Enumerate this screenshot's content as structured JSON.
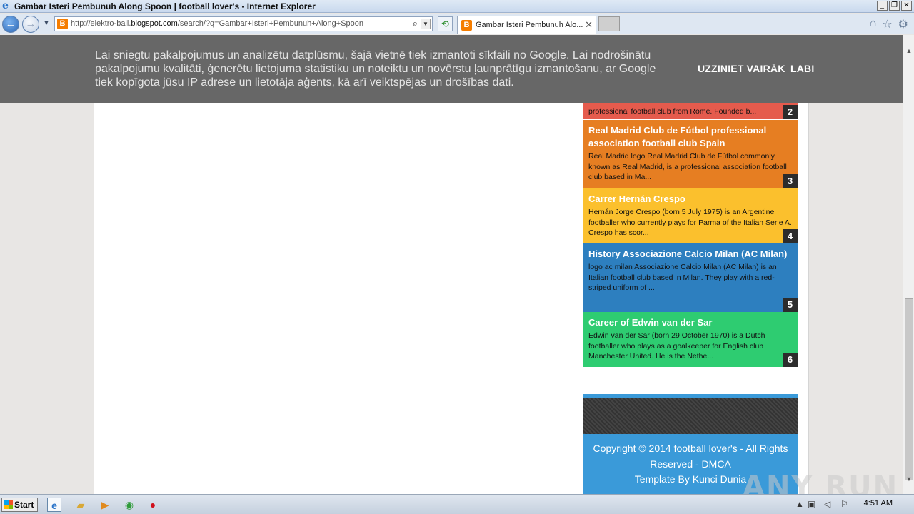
{
  "window": {
    "title": "Gambar Isteri Pembunuh Along Spoon | football lover's - Internet Explorer"
  },
  "navbar": {
    "url_prefix": "http://elektro-ball.",
    "url_domain": "blogspot.com",
    "url_suffix": "/search/?q=Gambar+Isteri+Pembunuh+Along+Spoon",
    "tab_title": "Gambar Isteri Pembunuh Alo..."
  },
  "cookie_banner": {
    "text": "Lai sniegtu pakalpojumus un analizētu datplūsmu, šajā vietnē tiek izmantoti sīkfaili no Google. Lai nodrošinātu pakalpojumu kvalitāti, ģenerētu lietojuma statistiku un noteiktu un novērstu ļaunprātīgu izmantošanu, ar Google tiek kopīgota jūsu IP adrese un lietotāja aģents, kā arī veiktspējas un drošības dati.",
    "learn_more": "UZZINIET VAIRĀK",
    "ok": "LABI"
  },
  "popular_posts": [
    {
      "title": "",
      "desc": "professional football club from Rome. Founded b...",
      "num": "2",
      "color": "#e55b4d"
    },
    {
      "title": "Real Madrid Club de Fútbol professional association football club Spain",
      "desc": " Real Madrid logo Real Madrid Club de Fútbol commonly known as Real Madrid, is a professional association football club based in Ma...",
      "num": "3",
      "color": "#e67e22"
    },
    {
      "title": "Carrer Hernán Crespo",
      "desc": "Hernán Jorge Crespo (born 5 July 1975) is an Argentine footballer who currently plays for Parma of the Italian Serie A. Crespo has scor...",
      "num": "4",
      "color": "#fbc02d"
    },
    {
      "title": "History Associazione Calcio Milan (AC Milan)",
      "desc": "logo  ac milan   Associazione Calcio Milan (AC Milan) is an Italian football club based in Milan. They play with a red-striped uniform of ...",
      "num": "5",
      "color": "#2d7fbf"
    },
    {
      "title": "Career of Edwin van der Sar",
      "desc": "Edwin van der Sar (born 29 October 1970) is a Dutch footballer who plays as a goalkeeper for English club Manchester United. He is the Nethe...",
      "num": "6",
      "color": "#2ecc71"
    }
  ],
  "footer": {
    "copyright": "Copyright © 2014 football lover's - All Rights",
    "reserved": "Reserved - DMCA",
    "template": "Template By Kunci Dunia"
  },
  "watermark": "ANY RUN",
  "taskbar": {
    "start": "Start",
    "clock": "4:51 AM"
  },
  "icons": [
    "ie-icon",
    "back-icon",
    "forward-icon",
    "search-icon",
    "refresh-icon",
    "blogger-icon",
    "close-icon",
    "home-icon",
    "star-icon",
    "gear-icon",
    "folder-icon",
    "media-icon",
    "chrome-icon",
    "opera-icon",
    "flag-icon",
    "speaker-icon",
    "network-icon"
  ]
}
